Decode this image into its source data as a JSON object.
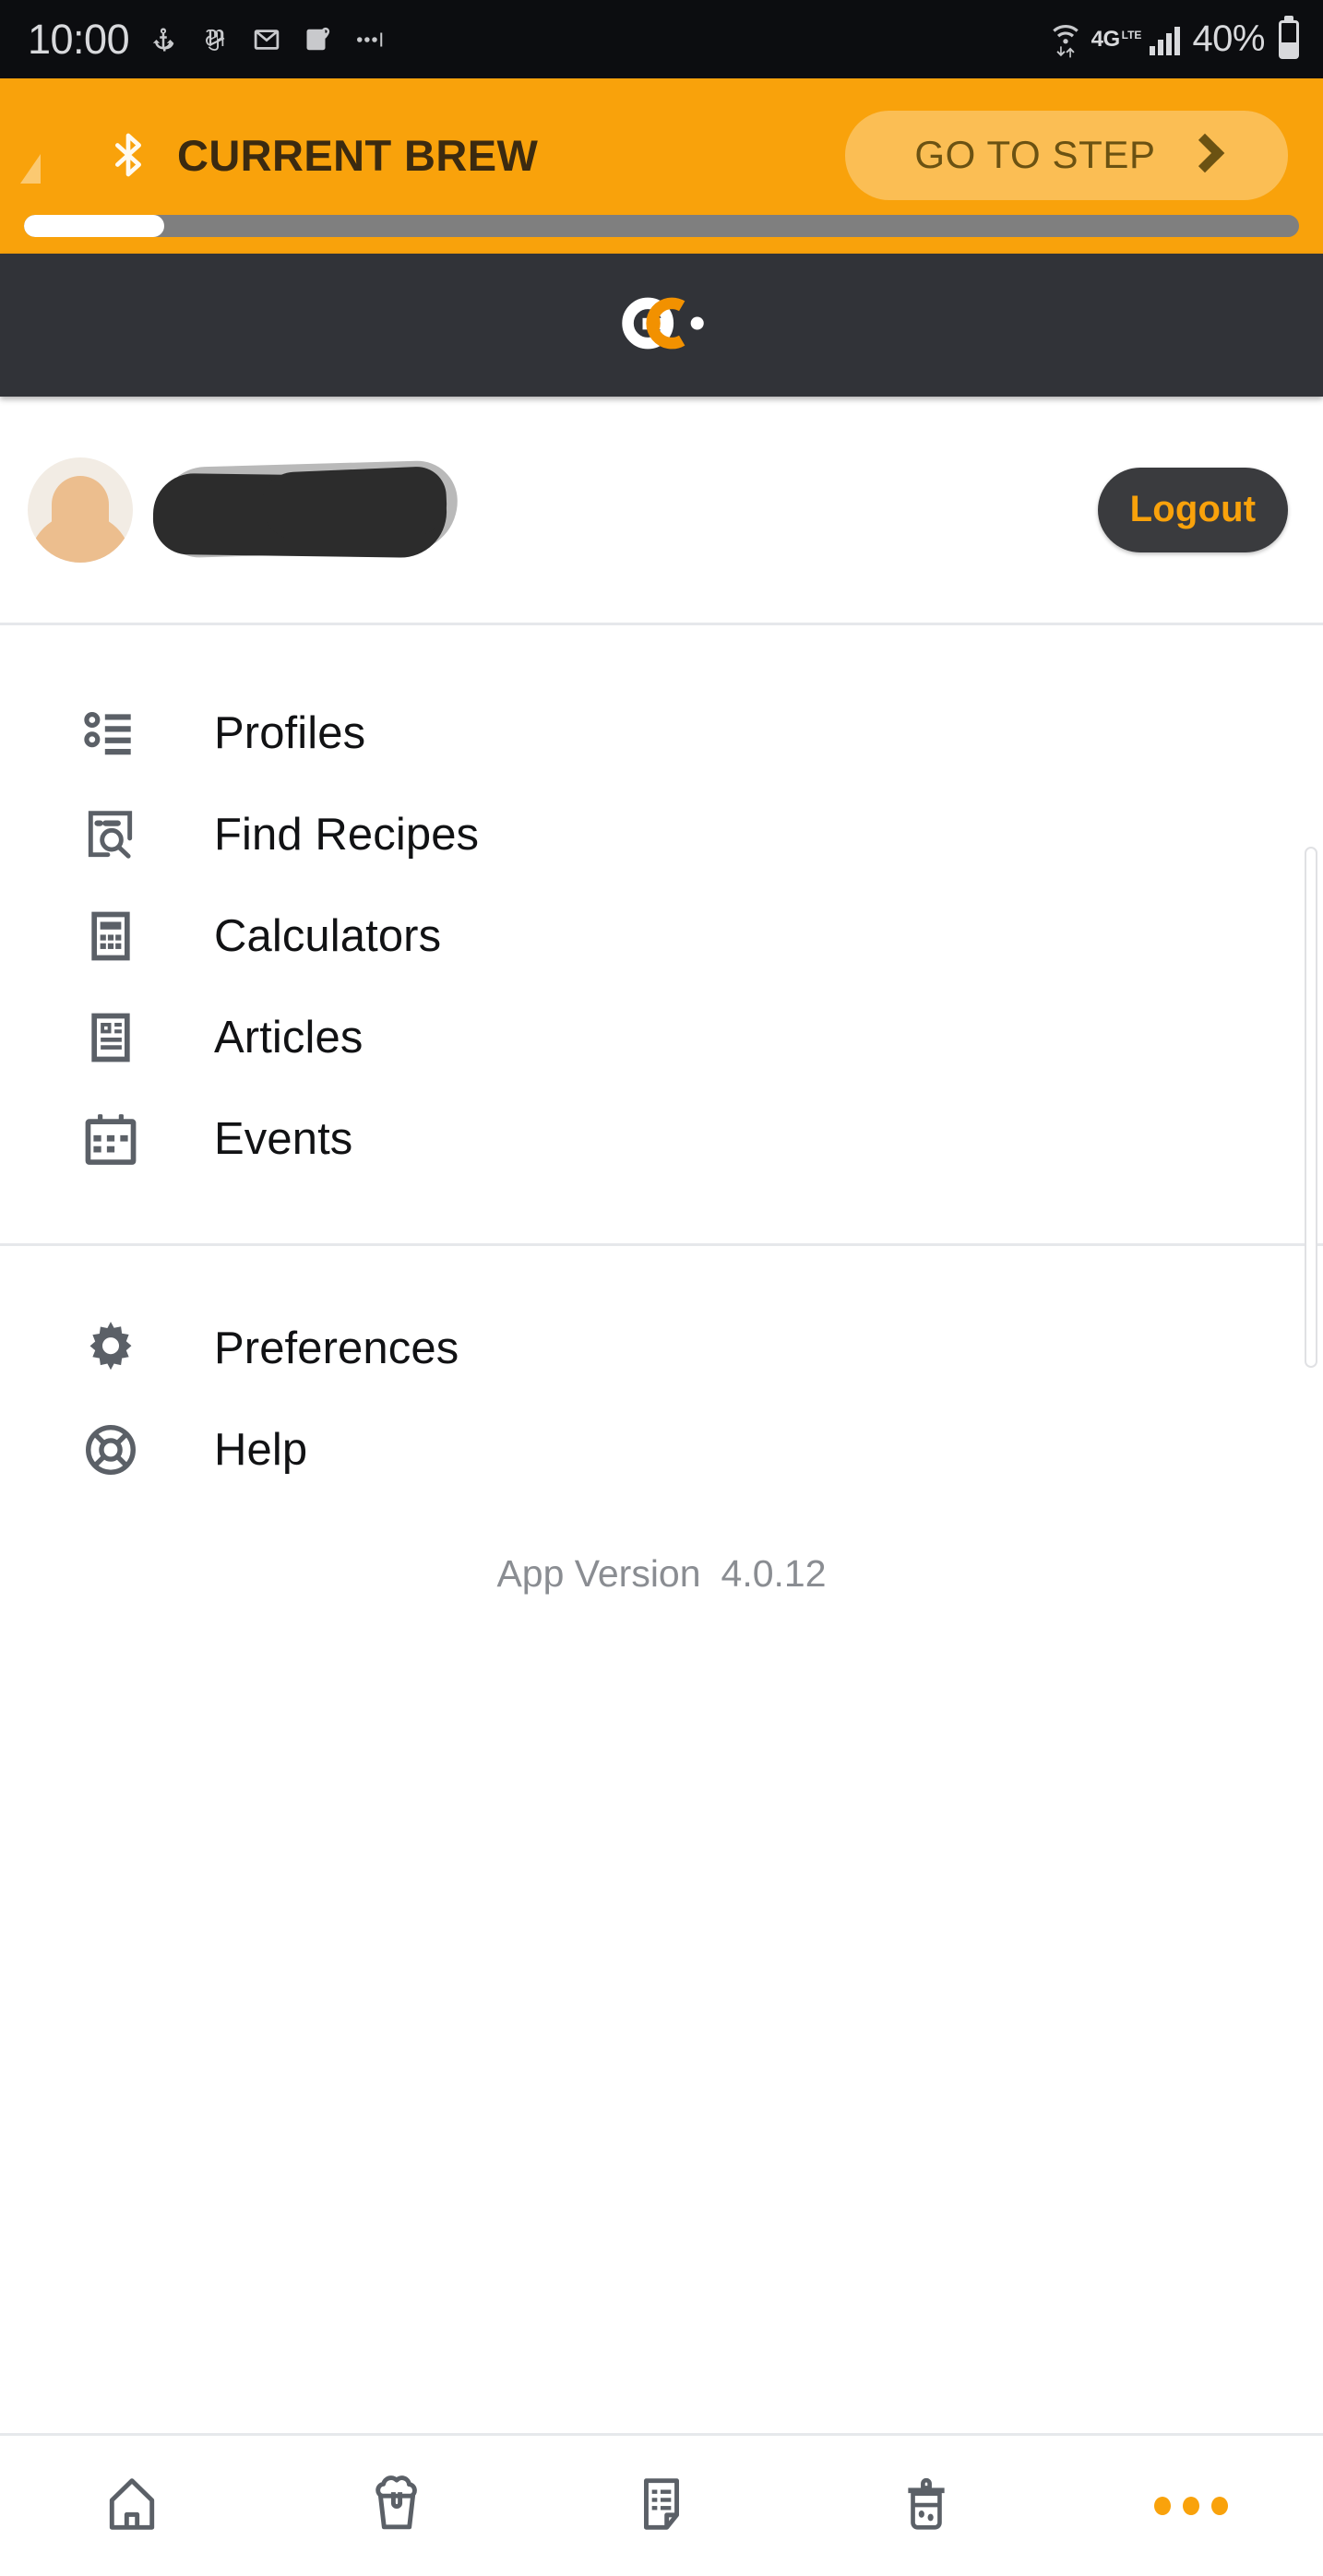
{
  "status_bar": {
    "time": "10:00",
    "notification_icons": [
      "anchor-icon",
      "nytimes-icon",
      "gmail-icon",
      "google-maps-icon",
      "more-notifications-icon"
    ],
    "wifi_icon": "wifi-data-transfer-icon",
    "network_type": "4G",
    "network_suffix": "LTE",
    "signal_icon": "cellular-signal-icon",
    "battery_percent": "40%",
    "battery_level": 40,
    "background_color": "#0c0d10",
    "foreground_color": "#d8d9dc"
  },
  "brew_banner": {
    "bluetooth_icon": "bluetooth-icon",
    "title": "CURRENT BREW",
    "goto_step_label": "GO TO STEP",
    "chevron_icon": "chevron-right-icon",
    "progress_percent": 11,
    "background_color": "#f9a20b",
    "text_color": "#3b2a10"
  },
  "logo_header": {
    "logo_name": "grainfather-gc-logo",
    "background_color": "#313338",
    "logo_white": "#ffffff",
    "logo_orange": "#f29100"
  },
  "profile": {
    "avatar_icon": "default-user-avatar",
    "username": "",
    "username_redacted": true,
    "logout_label": "Logout",
    "logout_bg": "#3a3b3e",
    "logout_text_color": "#f9a20b"
  },
  "menu": {
    "primary_items": [
      {
        "label": "Profiles",
        "icon": "list-bullets-icon"
      },
      {
        "label": "Find Recipes",
        "icon": "document-search-icon"
      },
      {
        "label": "Calculators",
        "icon": "calculator-icon"
      },
      {
        "label": "Articles",
        "icon": "article-icon"
      },
      {
        "label": "Events",
        "icon": "calendar-icon"
      }
    ],
    "secondary_items": [
      {
        "label": "Preferences",
        "icon": "gear-icon"
      },
      {
        "label": "Help",
        "icon": "lifebuoy-icon"
      }
    ],
    "icon_color": "#5b6067",
    "label_color": "#111214"
  },
  "footer": {
    "version_label": "App Version",
    "version_value": "4.0.12",
    "text_color": "#8a8d92"
  },
  "bottom_nav": {
    "items": [
      {
        "icon": "home-icon",
        "active": false
      },
      {
        "icon": "beer-glass-icon",
        "active": false
      },
      {
        "icon": "recipe-document-icon",
        "active": false
      },
      {
        "icon": "fermenter-icon",
        "active": false
      },
      {
        "icon": "more-dots-icon",
        "active": true
      }
    ],
    "active_color": "#f9a20b",
    "inactive_color": "#5b6067"
  }
}
